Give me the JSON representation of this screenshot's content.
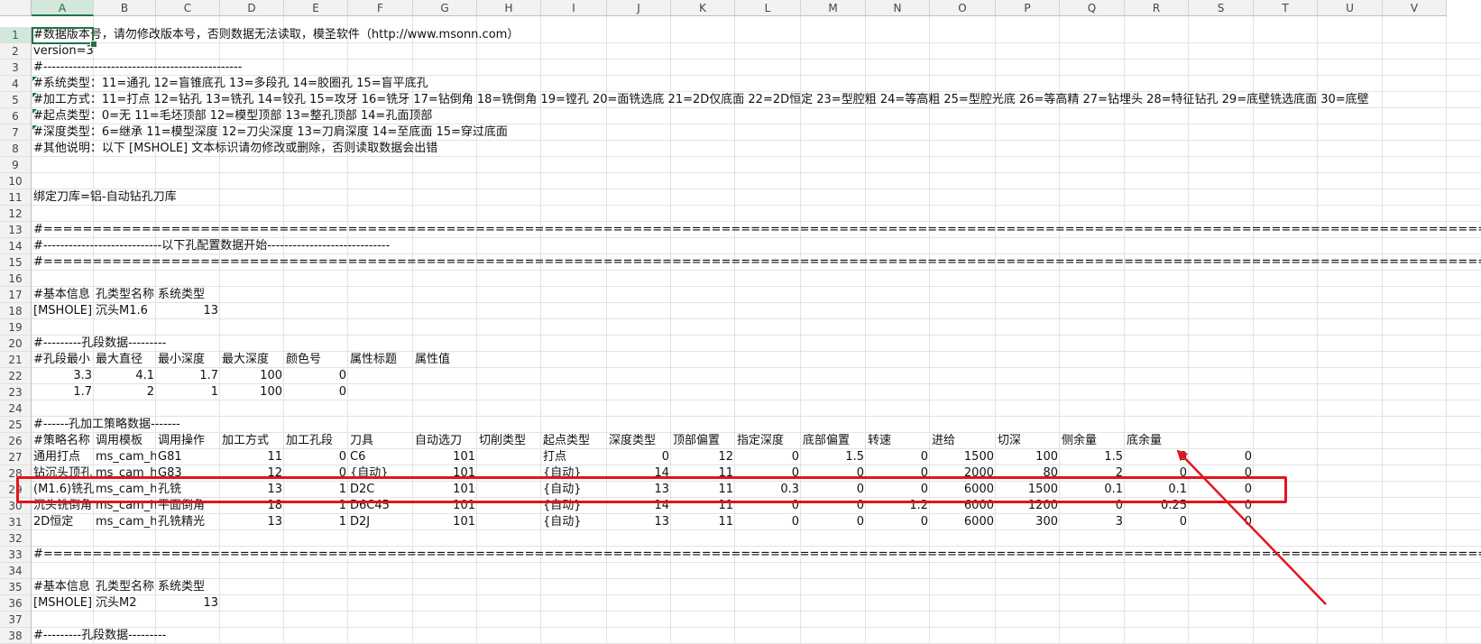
{
  "annotation_color": "#e4141c",
  "columns": [
    "A",
    "B",
    "C",
    "D",
    "E",
    "F",
    "G",
    "H",
    "I",
    "J",
    "K",
    "L",
    "M",
    "N",
    "O",
    "P",
    "Q",
    "R",
    "S",
    "T",
    "U",
    "V"
  ],
  "selected_column": "A",
  "selected_row": "1",
  "rows": [
    {
      "n": "1",
      "cells": [
        {
          "c": "A",
          "t": "#数据版本号，请勿修改版本号，否则数据无法读取，模圣软件（http://www.msonn.com）"
        }
      ]
    },
    {
      "n": "2",
      "cells": [
        {
          "c": "A",
          "t": "version=3"
        }
      ]
    },
    {
      "n": "3",
      "cells": [
        {
          "c": "A",
          "t": "#-----------------------------------------------"
        }
      ]
    },
    {
      "n": "4",
      "cells": [
        {
          "c": "A",
          "t": "#系统类型：11=通孔 12=盲锥底孔 13=多段孔 14=胶圈孔 15=盲平底孔"
        }
      ]
    },
    {
      "n": "5",
      "cells": [
        {
          "c": "A",
          "t": "#加工方式：11=打点 12=钻孔 13=铣孔 14=铰孔 15=攻牙 16=铣牙 17=钻倒角 18=铣倒角 19=镗孔 20=面铣选底 21=2D仅底面 22=2D恒定 23=型腔粗 24=等高粗 25=型腔光底 26=等高精 27=钻埋头 28=特征钻孔 29=底壁铣选底面 30=底壁"
        }
      ]
    },
    {
      "n": "6",
      "cells": [
        {
          "c": "A",
          "t": "#起点类型：0=无 11=毛坯顶部 12=模型顶部 13=整孔顶部 14=孔面顶部"
        }
      ]
    },
    {
      "n": "7",
      "cells": [
        {
          "c": "A",
          "t": "#深度类型：6=继承 11=模型深度 12=刀尖深度 13=刀肩深度 14=至底面 15=穿过底面"
        }
      ]
    },
    {
      "n": "8",
      "cells": [
        {
          "c": "A",
          "t": "#其他说明：以下 [MSHOLE] 文本标识请勿修改或删除，否则读取数据会出错"
        }
      ]
    },
    {
      "n": "9",
      "cells": []
    },
    {
      "n": "10",
      "cells": []
    },
    {
      "n": "11",
      "cells": [
        {
          "c": "A",
          "t": "绑定刀库=铝-自动钻孔刀库"
        }
      ]
    },
    {
      "n": "12",
      "cells": []
    },
    {
      "n": "13",
      "cells": [
        {
          "c": "A",
          "t": "#================================================================================================================================================================================="
        }
      ]
    },
    {
      "n": "14",
      "cells": [
        {
          "c": "A",
          "t": "#----------------------------以下孔配置数据开始-----------------------------"
        }
      ]
    },
    {
      "n": "15",
      "cells": [
        {
          "c": "A",
          "t": "#================================================================================================================================================================================="
        }
      ]
    },
    {
      "n": "16",
      "cells": []
    },
    {
      "n": "17",
      "cells": [
        {
          "c": "A",
          "t": "#基本信息"
        },
        {
          "c": "B",
          "t": "孔类型名称"
        },
        {
          "c": "C",
          "t": "系统类型"
        }
      ]
    },
    {
      "n": "18",
      "cells": [
        {
          "c": "A",
          "t": "[MSHOLE]"
        },
        {
          "c": "B",
          "t": "沉头M1.6"
        },
        {
          "c": "C",
          "t": "13",
          "num": true
        }
      ]
    },
    {
      "n": "19",
      "cells": []
    },
    {
      "n": "20",
      "cells": [
        {
          "c": "A",
          "t": "#---------孔段数据---------"
        }
      ]
    },
    {
      "n": "21",
      "cells": [
        {
          "c": "A",
          "t": "#孔段最小"
        },
        {
          "c": "B",
          "t": "最大直径"
        },
        {
          "c": "C",
          "t": "最小深度"
        },
        {
          "c": "D",
          "t": "最大深度"
        },
        {
          "c": "E",
          "t": "颜色号"
        },
        {
          "c": "F",
          "t": "属性标题"
        },
        {
          "c": "G",
          "t": "属性值"
        }
      ]
    },
    {
      "n": "22",
      "cells": [
        {
          "c": "A",
          "t": "3.3",
          "num": true
        },
        {
          "c": "B",
          "t": "4.1",
          "num": true
        },
        {
          "c": "C",
          "t": "1.7",
          "num": true
        },
        {
          "c": "D",
          "t": "100",
          "num": true
        },
        {
          "c": "E",
          "t": "0",
          "num": true
        }
      ]
    },
    {
      "n": "23",
      "cells": [
        {
          "c": "A",
          "t": "1.7",
          "num": true
        },
        {
          "c": "B",
          "t": "2",
          "num": true
        },
        {
          "c": "C",
          "t": "1",
          "num": true
        },
        {
          "c": "D",
          "t": "100",
          "num": true
        },
        {
          "c": "E",
          "t": "0",
          "num": true
        }
      ]
    },
    {
      "n": "24",
      "cells": []
    },
    {
      "n": "25",
      "cells": [
        {
          "c": "A",
          "t": "#------孔加工策略数据-------"
        }
      ]
    },
    {
      "n": "26",
      "cells": [
        {
          "c": "A",
          "t": "#策略名称"
        },
        {
          "c": "B",
          "t": "调用模板"
        },
        {
          "c": "C",
          "t": "调用操作"
        },
        {
          "c": "D",
          "t": "加工方式"
        },
        {
          "c": "E",
          "t": "加工孔段"
        },
        {
          "c": "F",
          "t": "刀具"
        },
        {
          "c": "G",
          "t": "自动选刀",
          "clip": true
        },
        {
          "c": "H",
          "t": "切削类型"
        },
        {
          "c": "I",
          "t": "起点类型"
        },
        {
          "c": "J",
          "t": "深度类型"
        },
        {
          "c": "K",
          "t": "顶部偏置"
        },
        {
          "c": "L",
          "t": "指定深度"
        },
        {
          "c": "M",
          "t": "底部偏置"
        },
        {
          "c": "N",
          "t": "转速"
        },
        {
          "c": "O",
          "t": "进给"
        },
        {
          "c": "P",
          "t": "切深"
        },
        {
          "c": "Q",
          "t": "侧余量"
        },
        {
          "c": "R",
          "t": "底余量"
        }
      ]
    },
    {
      "n": "27",
      "cells": [
        {
          "c": "A",
          "t": "通用打点"
        },
        {
          "c": "B",
          "t": "ms_cam_hole",
          "clip": true
        },
        {
          "c": "C",
          "t": "G81"
        },
        {
          "c": "D",
          "t": "11",
          "num": true
        },
        {
          "c": "E",
          "t": "0",
          "num": true
        },
        {
          "c": "F",
          "t": "C6"
        },
        {
          "c": "G",
          "t": "101",
          "num": true
        },
        {
          "c": "I",
          "t": "打点"
        },
        {
          "c": "J",
          "t": "0",
          "num": true
        },
        {
          "c": "K",
          "t": "12",
          "num": true
        },
        {
          "c": "L",
          "t": "0",
          "num": true
        },
        {
          "c": "M",
          "t": "1.5",
          "num": true
        },
        {
          "c": "N",
          "t": "0",
          "num": true
        },
        {
          "c": "O",
          "t": "1500",
          "num": true
        },
        {
          "c": "P",
          "t": "100",
          "num": true
        },
        {
          "c": "Q",
          "t": "1.5",
          "num": true
        },
        {
          "c": "R",
          "t": "0",
          "num": true
        },
        {
          "c": "S",
          "t": "0",
          "num": true
        }
      ]
    },
    {
      "n": "28",
      "cells": [
        {
          "c": "A",
          "t": "钻沉头顶孔",
          "clip": true
        },
        {
          "c": "B",
          "t": "ms_cam_hole",
          "clip": true
        },
        {
          "c": "C",
          "t": "G83"
        },
        {
          "c": "D",
          "t": "12",
          "num": true
        },
        {
          "c": "E",
          "t": "0",
          "num": true
        },
        {
          "c": "F",
          "t": "{自动}"
        },
        {
          "c": "G",
          "t": "101",
          "num": true
        },
        {
          "c": "I",
          "t": "{自动}"
        },
        {
          "c": "J",
          "t": "14",
          "num": true
        },
        {
          "c": "K",
          "t": "11",
          "num": true
        },
        {
          "c": "L",
          "t": "0",
          "num": true
        },
        {
          "c": "M",
          "t": "0",
          "num": true
        },
        {
          "c": "N",
          "t": "0",
          "num": true
        },
        {
          "c": "O",
          "t": "2000",
          "num": true
        },
        {
          "c": "P",
          "t": "80",
          "num": true
        },
        {
          "c": "Q",
          "t": "2",
          "num": true
        },
        {
          "c": "R",
          "t": "0",
          "num": true
        },
        {
          "c": "S",
          "t": "0",
          "num": true
        }
      ]
    },
    {
      "n": "29",
      "cells": [
        {
          "c": "A",
          "t": "(M1.6)铣孔",
          "clip": true
        },
        {
          "c": "B",
          "t": "ms_cam_hole",
          "clip": true
        },
        {
          "c": "C",
          "t": "孔铣"
        },
        {
          "c": "D",
          "t": "13",
          "num": true
        },
        {
          "c": "E",
          "t": "1",
          "num": true
        },
        {
          "c": "F",
          "t": "D2C"
        },
        {
          "c": "G",
          "t": "101",
          "num": true
        },
        {
          "c": "I",
          "t": "{自动}"
        },
        {
          "c": "J",
          "t": "13",
          "num": true
        },
        {
          "c": "K",
          "t": "11",
          "num": true
        },
        {
          "c": "L",
          "t": "0.3",
          "num": true
        },
        {
          "c": "M",
          "t": "0",
          "num": true
        },
        {
          "c": "N",
          "t": "0",
          "num": true
        },
        {
          "c": "O",
          "t": "6000",
          "num": true
        },
        {
          "c": "P",
          "t": "1500",
          "num": true
        },
        {
          "c": "Q",
          "t": "0.1",
          "num": true
        },
        {
          "c": "R",
          "t": "0.1",
          "num": true
        },
        {
          "c": "S",
          "t": "0",
          "num": true
        }
      ]
    },
    {
      "n": "30",
      "cells": [
        {
          "c": "A",
          "t": "沉头铣倒角",
          "clip": true
        },
        {
          "c": "B",
          "t": "ms_cam_hole",
          "clip": true
        },
        {
          "c": "C",
          "t": "平面倒角"
        },
        {
          "c": "D",
          "t": "18",
          "num": true
        },
        {
          "c": "E",
          "t": "1",
          "num": true
        },
        {
          "c": "F",
          "t": "D6C45"
        },
        {
          "c": "G",
          "t": "101",
          "num": true
        },
        {
          "c": "I",
          "t": "{自动}"
        },
        {
          "c": "J",
          "t": "14",
          "num": true
        },
        {
          "c": "K",
          "t": "11",
          "num": true
        },
        {
          "c": "L",
          "t": "0",
          "num": true
        },
        {
          "c": "M",
          "t": "0",
          "num": true
        },
        {
          "c": "N",
          "t": "1.2",
          "num": true
        },
        {
          "c": "O",
          "t": "6000",
          "num": true
        },
        {
          "c": "P",
          "t": "1200",
          "num": true
        },
        {
          "c": "Q",
          "t": "0",
          "num": true
        },
        {
          "c": "R",
          "t": "0.25",
          "num": true
        },
        {
          "c": "S",
          "t": "0",
          "num": true
        }
      ]
    },
    {
      "n": "31",
      "cells": [
        {
          "c": "A",
          "t": "2D恒定"
        },
        {
          "c": "B",
          "t": "ms_cam_hole",
          "clip": true
        },
        {
          "c": "C",
          "t": "孔铣精光"
        },
        {
          "c": "D",
          "t": "13",
          "num": true
        },
        {
          "c": "E",
          "t": "1",
          "num": true
        },
        {
          "c": "F",
          "t": "D2J"
        },
        {
          "c": "G",
          "t": "101",
          "num": true
        },
        {
          "c": "I",
          "t": "{自动}"
        },
        {
          "c": "J",
          "t": "13",
          "num": true
        },
        {
          "c": "K",
          "t": "11",
          "num": true
        },
        {
          "c": "L",
          "t": "0",
          "num": true
        },
        {
          "c": "M",
          "t": "0",
          "num": true
        },
        {
          "c": "N",
          "t": "0",
          "num": true
        },
        {
          "c": "O",
          "t": "6000",
          "num": true
        },
        {
          "c": "P",
          "t": "300",
          "num": true
        },
        {
          "c": "Q",
          "t": "3",
          "num": true
        },
        {
          "c": "R",
          "t": "0",
          "num": true
        },
        {
          "c": "S",
          "t": "0",
          "num": true
        }
      ]
    },
    {
      "n": "32",
      "cells": []
    },
    {
      "n": "33",
      "cells": [
        {
          "c": "A",
          "t": "#================================================================================================================================================================================="
        }
      ]
    },
    {
      "n": "34",
      "cells": []
    },
    {
      "n": "35",
      "cells": [
        {
          "c": "A",
          "t": "#基本信息"
        },
        {
          "c": "B",
          "t": "孔类型名称"
        },
        {
          "c": "C",
          "t": "系统类型"
        }
      ]
    },
    {
      "n": "36",
      "cells": [
        {
          "c": "A",
          "t": "[MSHOLE]"
        },
        {
          "c": "B",
          "t": "沉头M2"
        },
        {
          "c": "C",
          "t": "13",
          "num": true
        }
      ]
    },
    {
      "n": "37",
      "cells": []
    },
    {
      "n": "38",
      "cells": [
        {
          "c": "A",
          "t": "#---------孔段数据---------"
        }
      ]
    }
  ]
}
